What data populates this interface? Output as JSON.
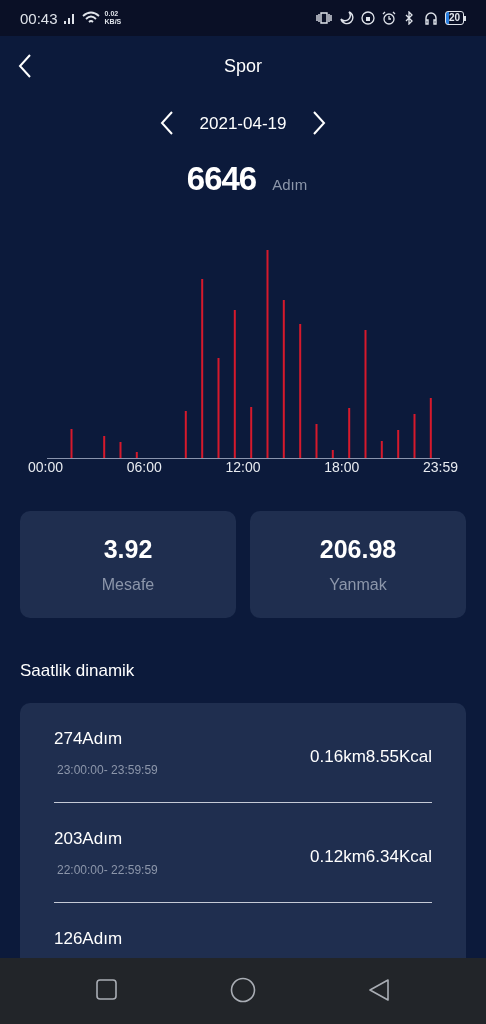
{
  "status_bar": {
    "time": "00:43",
    "net_speed": "0.02",
    "net_unit": "KB/S",
    "battery": "20"
  },
  "header": {
    "title": "Spor"
  },
  "date_nav": {
    "date": "2021-04-19"
  },
  "total": {
    "value": "6646",
    "unit": "Adım"
  },
  "chart": {
    "x_labels": [
      "00:00",
      "06:00",
      "12:00",
      "18:00",
      "23:59"
    ]
  },
  "stats": [
    {
      "value": "3.92",
      "label": "Mesafe"
    },
    {
      "value": "206.98",
      "label": "Yanmak"
    }
  ],
  "section_title": "Saatlik dinamik",
  "hours": [
    {
      "steps": "274Adım",
      "range": "23:00:00- 23:59:59",
      "summary": "0.16km8.55Kcal"
    },
    {
      "steps": "203Adım",
      "range": "22:00:00- 22:59:59",
      "summary": "0.12km6.34Kcal"
    },
    {
      "steps": "126Adım"
    }
  ]
}
